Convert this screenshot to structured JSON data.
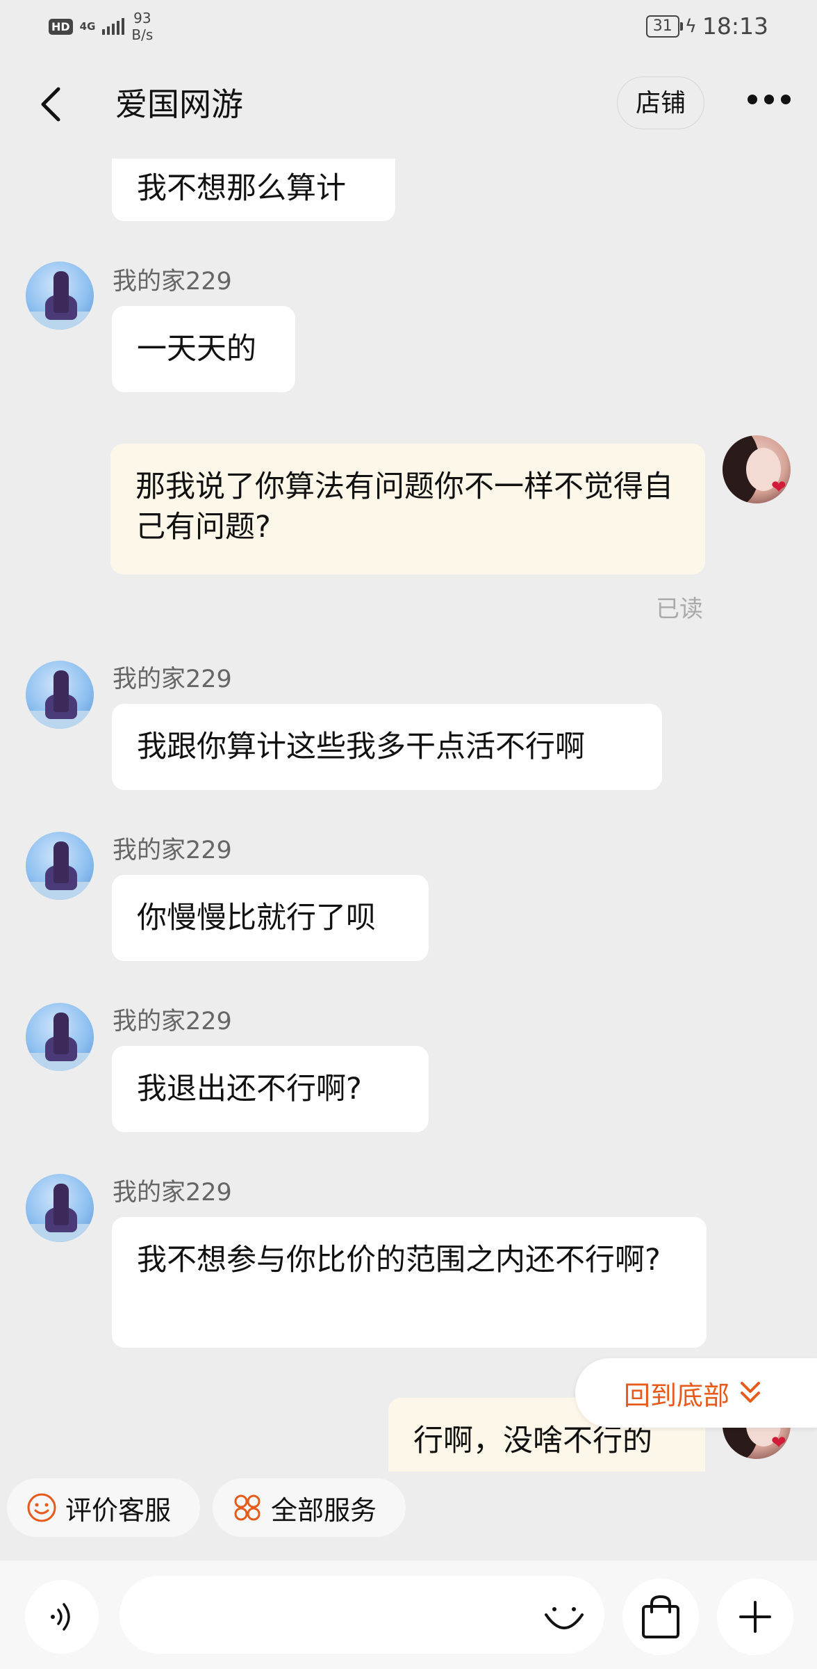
{
  "status_bar": {
    "hd": "HD",
    "network": "4G",
    "speed_value": "93",
    "speed_unit": "B/s",
    "battery": "31",
    "time": "18:13"
  },
  "header": {
    "title": "爱国网游",
    "shop_label": "店铺"
  },
  "messages": [
    {
      "side": "in",
      "text": "我不想那么算计"
    },
    {
      "side": "in",
      "sender": "我的家229",
      "text": "一天天的"
    },
    {
      "side": "out",
      "text": "那我说了你算法有问题你不一样不觉得自己有问题?",
      "status": "已读"
    },
    {
      "side": "in",
      "sender": "我的家229",
      "text": "我跟你算计这些我多干点活不行啊"
    },
    {
      "side": "in",
      "sender": "我的家229",
      "text": "你慢慢比就行了呗"
    },
    {
      "side": "in",
      "sender": "我的家229",
      "text": "我退出还不行啊?"
    },
    {
      "side": "in",
      "sender": "我的家229",
      "text": "我不想参与你比价的范围之内还不行啊?"
    },
    {
      "side": "out",
      "text": "行啊，没啥不行的"
    }
  ],
  "scroll_to_bottom": "回到底部",
  "quick_actions": [
    {
      "label": "评价客服",
      "icon": "smile-icon"
    },
    {
      "label": "全部服务",
      "icon": "grid-icon"
    }
  ],
  "input": {
    "value": "",
    "placeholder": ""
  },
  "colors": {
    "accent": "#e65a1c",
    "background": "#ededed",
    "outgoing_bubble": "#fdf7ea",
    "incoming_bubble": "#ffffff"
  }
}
